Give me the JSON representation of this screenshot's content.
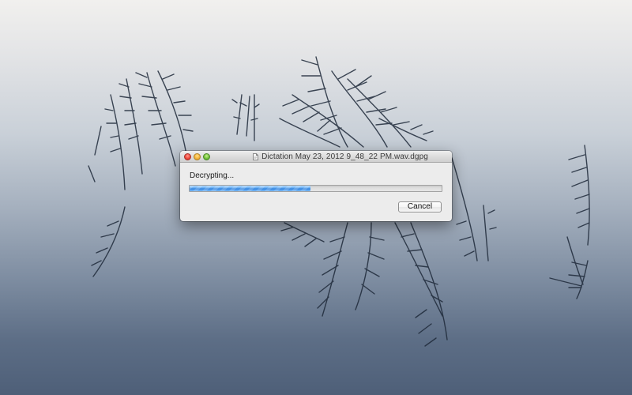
{
  "window": {
    "title": "Dictation May 23, 2012 9_48_22 PM.wav.dgpg"
  },
  "dialog": {
    "status_text": "Decrypting...",
    "progress_fraction": 0.48,
    "cancel_label": "Cancel"
  },
  "icons": {
    "close": "close-button-icon",
    "minimize": "minimize-button-icon",
    "zoom": "zoom-button-icon",
    "document": "document-icon"
  },
  "colors": {
    "close": "#f0473a",
    "minimize": "#f4b43a",
    "zoom": "#72c33c",
    "progress": "#2f7fdc",
    "reeds": "#1f2a3a"
  }
}
